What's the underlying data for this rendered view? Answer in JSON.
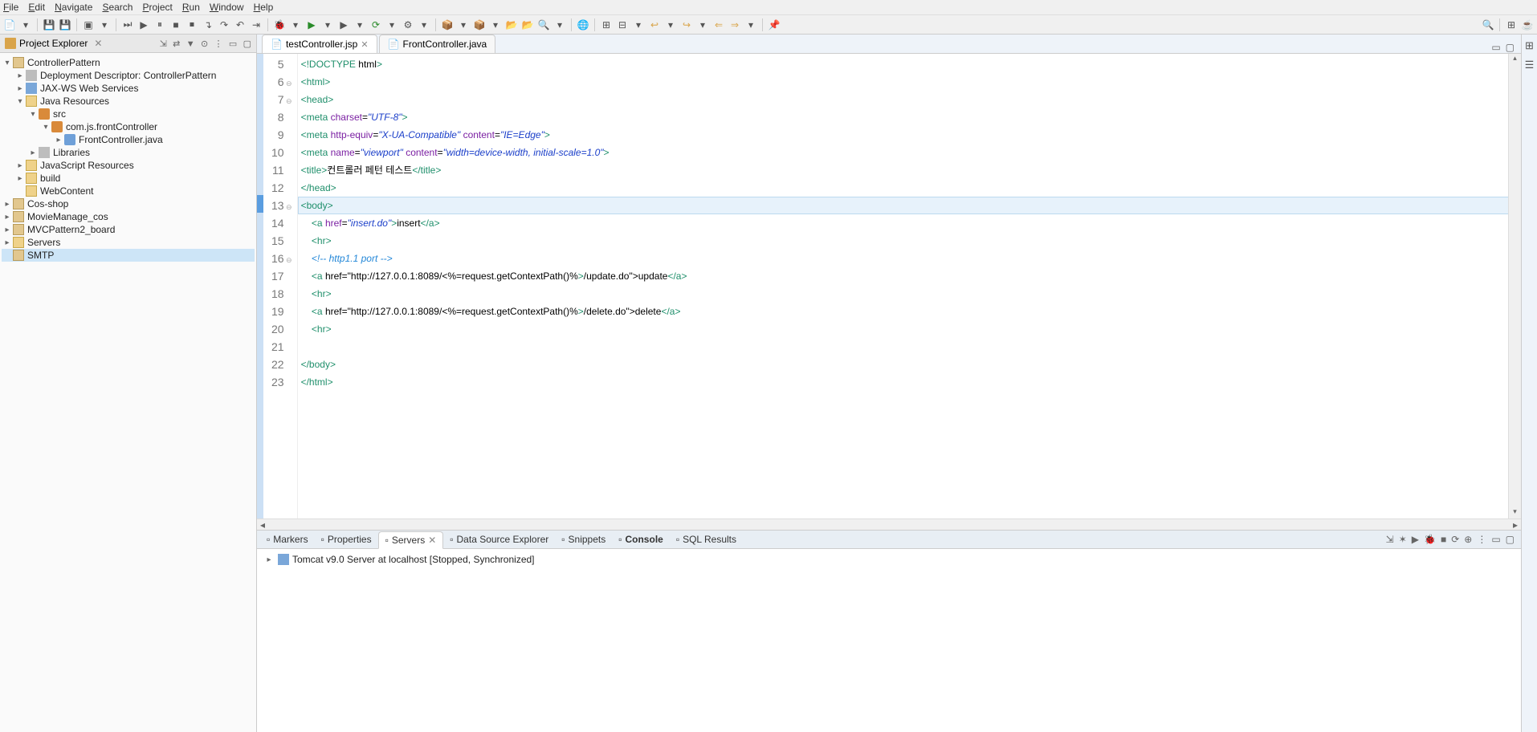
{
  "menu": {
    "items": [
      "File",
      "Edit",
      "Navigate",
      "Search",
      "Project",
      "Run",
      "Window",
      "Help"
    ]
  },
  "explorer": {
    "title": "Project Explorer",
    "tree": {
      "root": "ControllerPattern",
      "dd": "Deployment Descriptor: ControllerPattern",
      "jaxws": "JAX-WS Web Services",
      "jres": "Java Resources",
      "src": "src",
      "pkg": "com.js.frontController",
      "file": "FrontController.java",
      "lib": "Libraries",
      "jsres": "JavaScript Resources",
      "build": "build",
      "webcontent": "WebContent",
      "cos": "Cos-shop",
      "movie": "MovieManage_cos",
      "mvc": "MVCPattern2_board",
      "servers": "Servers",
      "smtp": "SMTP"
    }
  },
  "tabs": {
    "active": "testController.jsp",
    "inactive": "FrontController.java"
  },
  "editor": {
    "lines": [
      {
        "n": 5,
        "fold": "",
        "hl": false,
        "raw": "<!DOCTYPE html>"
      },
      {
        "n": 6,
        "fold": "⊖",
        "hl": false,
        "raw": "<html>"
      },
      {
        "n": 7,
        "fold": "⊖",
        "hl": false,
        "raw": "<head>"
      },
      {
        "n": 8,
        "fold": "",
        "hl": false,
        "raw": "<meta charset=\"UTF-8\">"
      },
      {
        "n": 9,
        "fold": "",
        "hl": false,
        "raw": "<meta http-equiv=\"X-UA-Compatible\" content=\"IE=Edge\">"
      },
      {
        "n": 10,
        "fold": "",
        "hl": false,
        "raw": "<meta name=\"viewport\" content=\"width=device-width, initial-scale=1.0\">"
      },
      {
        "n": 11,
        "fold": "",
        "hl": false,
        "raw": "<title>컨트롤러 페턴 테스트</title>"
      },
      {
        "n": 12,
        "fold": "",
        "hl": false,
        "raw": "</head>"
      },
      {
        "n": 13,
        "fold": "⊖",
        "hl": true,
        "raw": "<body>"
      },
      {
        "n": 14,
        "fold": "",
        "hl": false,
        "raw": "    <a href=\"insert.do\">insert</a>"
      },
      {
        "n": 15,
        "fold": "",
        "hl": false,
        "raw": "    <hr>"
      },
      {
        "n": 16,
        "fold": "⊖",
        "hl": false,
        "raw": "    <!-- http1.1 port -->"
      },
      {
        "n": 17,
        "fold": "",
        "hl": false,
        "raw": "    <a href=\"http://127.0.0.1:8089/<%=request.getContextPath()%>/update.do\">update</a>"
      },
      {
        "n": 18,
        "fold": "",
        "hl": false,
        "raw": "    <hr>"
      },
      {
        "n": 19,
        "fold": "",
        "hl": false,
        "raw": "    <a href=\"http://127.0.0.1:8089/<%=request.getContextPath()%>/delete.do\">delete</a>"
      },
      {
        "n": 20,
        "fold": "",
        "hl": false,
        "raw": "    <hr>"
      },
      {
        "n": 21,
        "fold": "",
        "hl": false,
        "raw": ""
      },
      {
        "n": 22,
        "fold": "",
        "hl": false,
        "raw": "</body>"
      },
      {
        "n": 23,
        "fold": "",
        "hl": false,
        "raw": "</html>"
      }
    ]
  },
  "bottom": {
    "tabs": [
      "Markers",
      "Properties",
      "Servers",
      "Data Source Explorer",
      "Snippets",
      "Console",
      "SQL Results"
    ],
    "active": "Servers",
    "server": "Tomcat v9.0 Server at localhost  [Stopped, Synchronized]"
  }
}
